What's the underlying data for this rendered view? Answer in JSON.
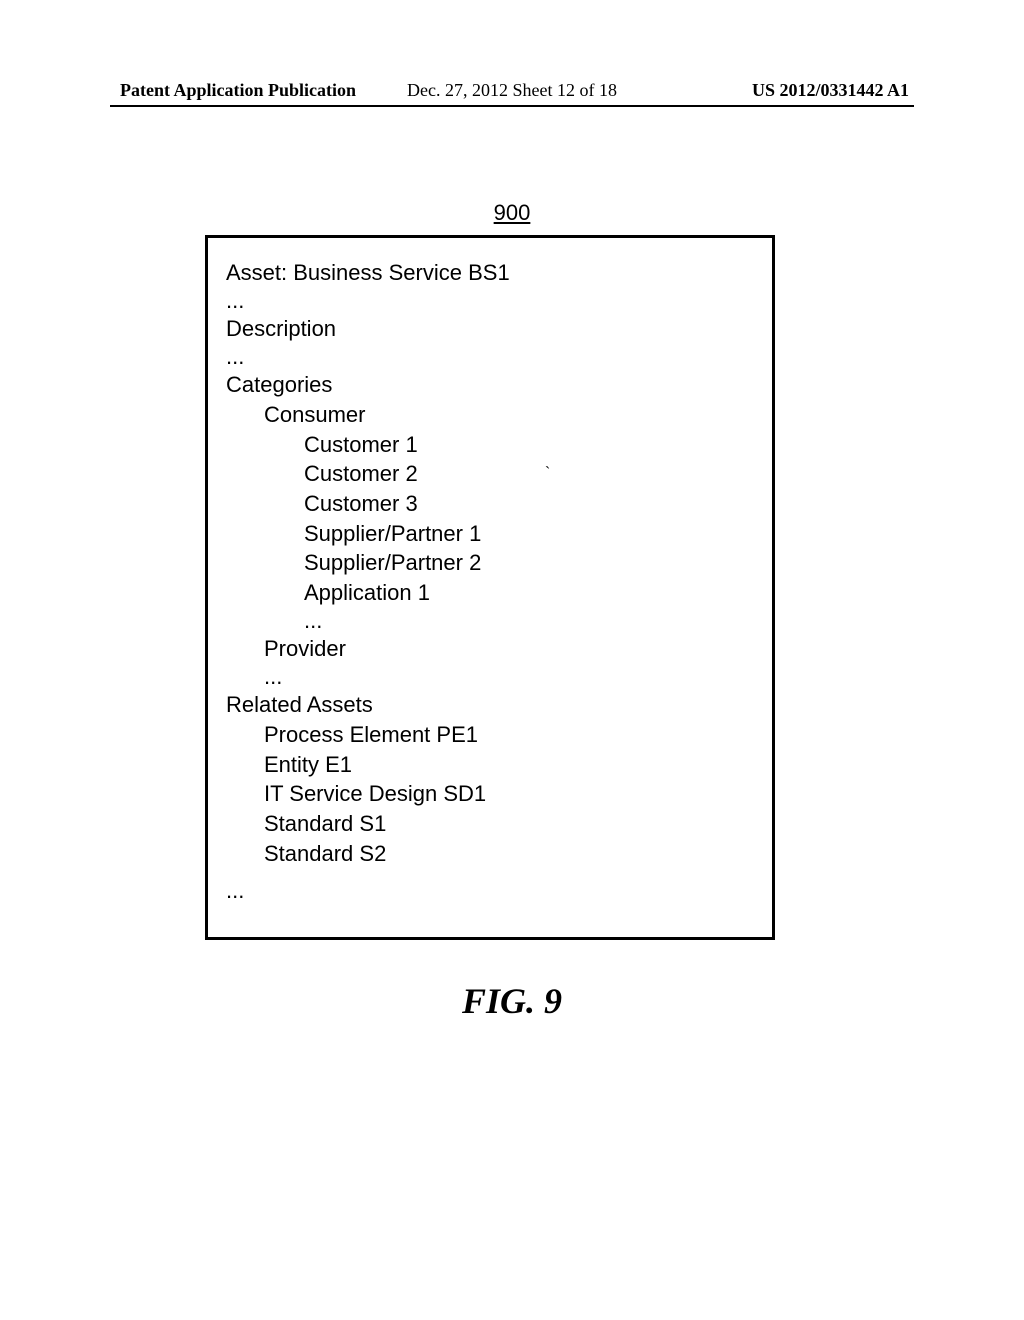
{
  "header": {
    "left": "Patent Application Publication",
    "center": "Dec. 27, 2012  Sheet 12 of 18",
    "right": "US 2012/0331442 A1"
  },
  "figure_number": "900",
  "box": {
    "asset_line": "Asset: Business Service BS1",
    "description_label": "Description",
    "categories_label": "Categories",
    "consumer_label": "Consumer",
    "consumers": [
      "Customer 1",
      "Customer 2",
      "Customer 3",
      "Supplier/Partner 1",
      "Supplier/Partner 2",
      "Application 1"
    ],
    "provider_label": "Provider",
    "related_assets_label": "Related Assets",
    "related_assets": [
      "Process Element PE1",
      "Entity E1",
      "IT Service Design SD1",
      "Standard S1",
      "Standard S2"
    ],
    "ellipsis": "…",
    "dots": "..."
  },
  "stray_mark": "`",
  "figure_caption": "FIG. 9"
}
